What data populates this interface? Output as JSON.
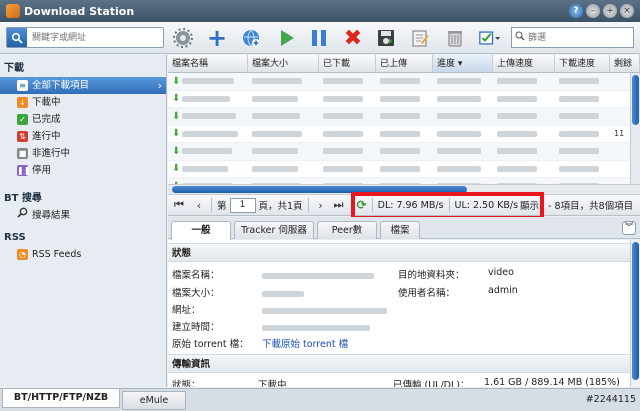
{
  "app": {
    "title": "Download Station"
  },
  "window_buttons": [
    "?",
    "–",
    "+",
    "×"
  ],
  "toolbar": {
    "search_placeholder": "關鍵字或網址",
    "filter_placeholder": "篩選",
    "icons": [
      "settings-icon",
      "add-icon",
      "add-url-icon",
      "resume-icon",
      "pause-icon",
      "delete-icon",
      "save-icon",
      "edit-icon",
      "trash-icon",
      "checklist-icon"
    ]
  },
  "sidebar": {
    "download_header": "下載",
    "items": [
      {
        "label": "全部下載項目",
        "active": true,
        "color": "#ffffff"
      },
      {
        "label": "下載中",
        "color": "#f08a24"
      },
      {
        "label": "已完成",
        "color": "#3aa63a"
      },
      {
        "label": "進行中",
        "color": "#d93b2b"
      },
      {
        "label": "非進行中",
        "color": "#888888"
      },
      {
        "label": "停用",
        "color": "#8a63c7"
      }
    ],
    "bt_header": "BT 搜尋",
    "bt_item": "搜尋結果",
    "rss_header": "RSS",
    "rss_item": "RSS Feeds"
  },
  "grid": {
    "columns": [
      "檔案名稱",
      "檔案大小",
      "已下載",
      "已上傳",
      "進度",
      "上傳速度",
      "下載速度",
      "剩餘"
    ],
    "rows": [
      {
        "name": "",
        "extra": ""
      },
      {
        "name": "",
        "extra": ""
      },
      {
        "name": "",
        "extra": ""
      },
      {
        "name": "",
        "extra": "11"
      },
      {
        "name": "",
        "extra": ""
      },
      {
        "name": "",
        "extra": ""
      },
      {
        "name": "",
        "extra": ""
      }
    ]
  },
  "pager": {
    "page_label": "第",
    "page_value": "1",
    "page_suffix": "頁，共1頁",
    "dl_speed": "DL: 7.96 MB/s",
    "ul_speed": "UL: 2.50 KB/s",
    "summary": "顯示1 - 8項目，共8個項目"
  },
  "tabs": [
    "一般",
    "Tracker 伺服器",
    "Peer數",
    "檔案"
  ],
  "detail": {
    "status_section": "狀態",
    "filename_label": "檔案名稱：",
    "filesize_label": "檔案大小：",
    "url_label": "網址：",
    "created_label": "建立時間：",
    "torrent_label": "原始 torrent 檔：",
    "torrent_link": "下載原始 torrent 檔",
    "dest_label": "目的地資料夾：",
    "dest_value": "video",
    "user_label": "使用者名稱：",
    "user_value": "admin",
    "transfer_section": "傳輸資訊",
    "state_label": "狀態：",
    "state_value": "下載中",
    "transferred_label": "已傳輸 (UL/DL)：",
    "transferred_value": "1.61 GB / 889.14 MB (185%)"
  },
  "bottom_tabs": [
    "BT/HTTP/FTP/NZB",
    "eMule"
  ],
  "watermark": "#2244115",
  "colors": {
    "accent": "#2e6db8",
    "highlight": "#e8141e",
    "titlebar": "#3d5368"
  }
}
